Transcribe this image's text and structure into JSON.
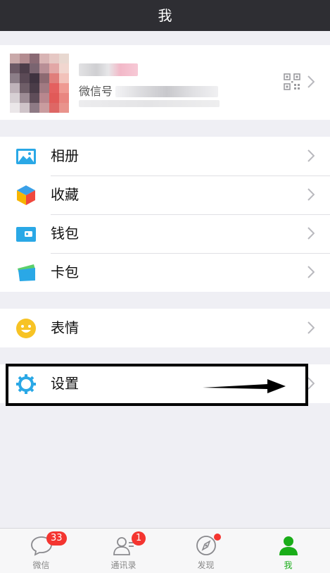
{
  "header": {
    "title": "我"
  },
  "profile": {
    "wechat_id_label": "微信号"
  },
  "menu_group_1": [
    {
      "label": "相册",
      "icon": "photo-album-icon"
    },
    {
      "label": "收藏",
      "icon": "favorites-cube-icon"
    },
    {
      "label": "钱包",
      "icon": "wallet-icon"
    },
    {
      "label": "卡包",
      "icon": "card-pack-icon"
    }
  ],
  "menu_group_2": [
    {
      "label": "表情",
      "icon": "emoji-smiley-icon"
    }
  ],
  "menu_group_3": [
    {
      "label": "设置",
      "icon": "settings-gear-icon"
    }
  ],
  "tabbar": {
    "tabs": [
      {
        "label": "微信",
        "icon": "chat-bubble-icon",
        "badge": "33",
        "active": false
      },
      {
        "label": "通讯录",
        "icon": "contacts-icon",
        "badge": "1",
        "active": false
      },
      {
        "label": "发现",
        "icon": "compass-icon",
        "badge_dot": true,
        "active": false
      },
      {
        "label": "我",
        "icon": "person-icon",
        "active": true
      }
    ]
  },
  "colors": {
    "nav_bg": "#2e2e33",
    "page_bg": "#efeff4",
    "active_tab": "#1aad19",
    "badge": "#f43530",
    "icon_blue": "#2aa8e6"
  }
}
